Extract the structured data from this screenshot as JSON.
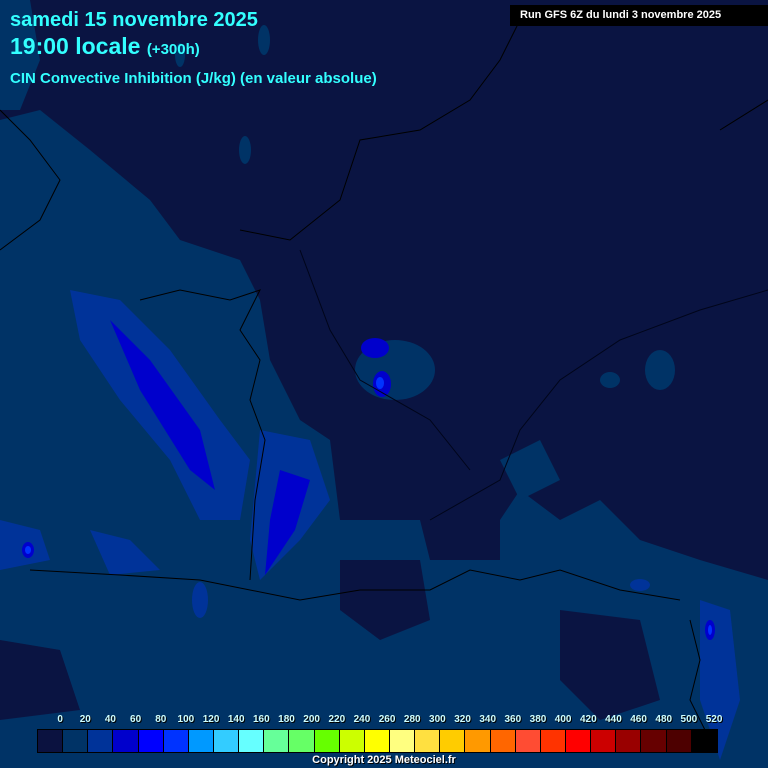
{
  "header": {
    "date": "samedi 15 novembre 2025",
    "time": "19:00 locale",
    "lead": "(+300h)",
    "parameter": "CIN Convective Inhibition (J/kg) (en valeur absolue)"
  },
  "run_label": "Run GFS 6Z du lundi 3 novembre 2025",
  "legend": {
    "labels": [
      "0",
      "20",
      "40",
      "60",
      "80",
      "100",
      "120",
      "140",
      "160",
      "180",
      "200",
      "220",
      "240",
      "260",
      "280",
      "300",
      "320",
      "340",
      "360",
      "380",
      "400",
      "420",
      "440",
      "460",
      "480",
      "500",
      "520"
    ],
    "colors": [
      "#0b1240",
      "#003366",
      "#003399",
      "#0000cc",
      "#0000ff",
      "#0033ff",
      "#0099ff",
      "#33ccff",
      "#66ffff",
      "#66ff99",
      "#66ff66",
      "#66ff00",
      "#ccff00",
      "#ffff00",
      "#ffff80",
      "#ffe040",
      "#ffcc00",
      "#ff9900",
      "#ff6600",
      "#ff4c33",
      "#ff3300",
      "#ff0000",
      "#cc0000",
      "#990000",
      "#660000",
      "#4d0000",
      "#000000"
    ]
  },
  "copyright": "Copyright 2025 Meteociel.fr"
}
